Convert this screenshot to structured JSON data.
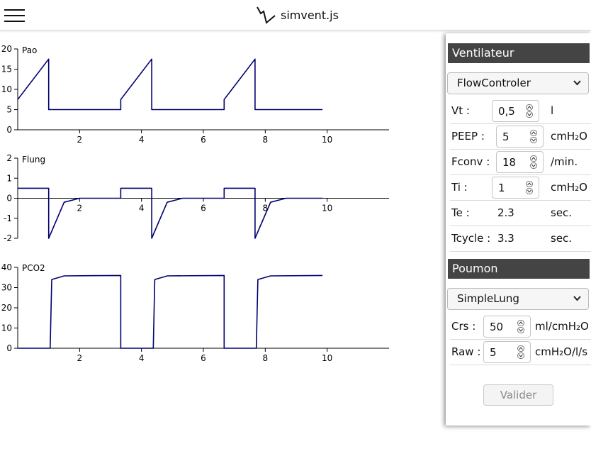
{
  "header": {
    "menu_icon": "hamburger-menu-icon",
    "logo_icon": "breath-wave-logo-icon",
    "title": "simvent.js"
  },
  "charts": {
    "pao_label": "Pao",
    "flung_label": "Flung",
    "pco2_label": "PCO2"
  },
  "chart_data": [
    {
      "type": "line",
      "series": [
        {
          "name": "Pao",
          "x": [
            0,
            1.0,
            1.0,
            3.33,
            3.33,
            4.33,
            4.33,
            6.67,
            6.67,
            7.67,
            7.67,
            9.85
          ],
          "y": [
            7.5,
            17.5,
            5,
            5,
            7.5,
            17.5,
            5,
            5,
            7.5,
            17.5,
            5,
            5
          ]
        }
      ],
      "xticks": [
        "2",
        "4",
        "6",
        "8",
        "10"
      ],
      "yticks": [
        "0",
        "5",
        "10",
        "15",
        "20"
      ],
      "xlim": [
        0,
        12
      ],
      "ylim": [
        0,
        20
      ]
    },
    {
      "type": "line",
      "series": [
        {
          "name": "Flung",
          "x": [
            0,
            1.0,
            1.0,
            1.5,
            2.0,
            3.33,
            3.33,
            4.33,
            4.33,
            4.83,
            5.33,
            6.67,
            6.67,
            7.67,
            7.67,
            8.17,
            8.67,
            9.85
          ],
          "y": [
            0.5,
            0.5,
            -2.0,
            -0.2,
            0,
            0,
            0.5,
            0.5,
            -2.0,
            -0.2,
            0,
            0,
            0.5,
            0.5,
            -2.0,
            -0.2,
            0,
            0
          ]
        }
      ],
      "xticks": [
        "2",
        "4",
        "6",
        "8",
        "10"
      ],
      "yticks": [
        "-2",
        "-1",
        "0",
        "1",
        "2"
      ],
      "xlim": [
        0,
        12
      ],
      "ylim": [
        -2,
        2
      ]
    },
    {
      "type": "line",
      "series": [
        {
          "name": "PCO2",
          "x": [
            0,
            1.05,
            1.1,
            1.5,
            3.33,
            3.33,
            4.38,
            4.43,
            4.83,
            6.67,
            6.67,
            7.71,
            7.76,
            8.17,
            9.85
          ],
          "y": [
            0,
            0,
            34,
            35.8,
            36,
            0,
            0,
            34,
            35.8,
            36,
            0,
            0,
            34,
            35.8,
            36
          ]
        }
      ],
      "xticks": [
        "2",
        "4",
        "6",
        "8",
        "10"
      ],
      "yticks": [
        "0",
        "10",
        "20",
        "30",
        "40"
      ],
      "xlim": [
        0,
        12
      ],
      "ylim": [
        0,
        40
      ]
    }
  ],
  "ventilator": {
    "header": "Ventilateur",
    "model": "FlowControler",
    "vt": {
      "label": "Vt :",
      "value": "0,5",
      "unit": "l"
    },
    "peep": {
      "label": "PEEP :",
      "value": "5",
      "unit": "cmH₂O"
    },
    "fconv": {
      "label": "Fconv :",
      "value": "18",
      "unit": "/min."
    },
    "ti": {
      "label": "Ti :",
      "value": "1",
      "unit": "cmH₂O"
    },
    "te": {
      "label": "Te :",
      "value": "2.3",
      "unit": "sec."
    },
    "tcycle": {
      "label": "Tcycle :",
      "value": "3.3",
      "unit": "sec."
    }
  },
  "lung": {
    "header": "Poumon",
    "model": "SimpleLung",
    "crs": {
      "label": "Crs :",
      "value": "50",
      "unit": "ml/cmH₂O"
    },
    "raw": {
      "label": "Raw :",
      "value": "5",
      "unit": "cmH₂O/l/s"
    }
  },
  "actions": {
    "submit": "Valider"
  },
  "colors": {
    "trace": "#000070",
    "header_bg": "#444444"
  }
}
